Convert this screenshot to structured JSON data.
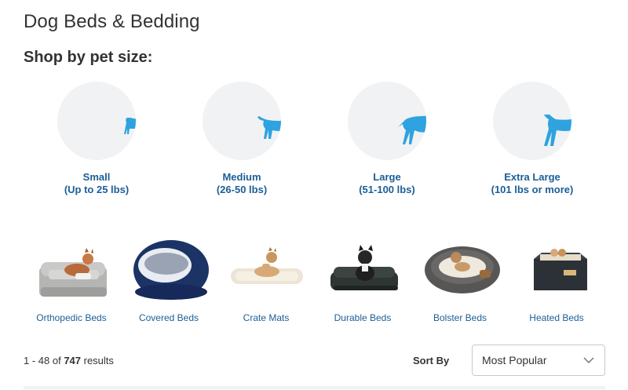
{
  "page": {
    "title": "Dog Beds & Bedding",
    "section_title": "Shop by pet size:"
  },
  "sizes": [
    {
      "name": "Small",
      "range": "(Up to 25 lbs)",
      "icon": "small-dog-icon"
    },
    {
      "name": "Medium",
      "range": "(26-50 lbs)",
      "icon": "medium-dog-icon"
    },
    {
      "name": "Large",
      "range": "(51-100 lbs)",
      "icon": "large-dog-icon"
    },
    {
      "name": "Extra Large",
      "range": "(101 lbs or more)",
      "icon": "extra-large-dog-icon"
    }
  ],
  "categories": [
    {
      "label": "Orthopedic Beds"
    },
    {
      "label": "Covered Beds"
    },
    {
      "label": "Crate Mats"
    },
    {
      "label": "Durable Beds"
    },
    {
      "label": "Bolster Beds"
    },
    {
      "label": "Heated Beds"
    }
  ],
  "results": {
    "prefix": "1 - 48 of ",
    "count": "747",
    "suffix": " results"
  },
  "sort": {
    "label": "Sort By",
    "selected": "Most Popular"
  },
  "colors": {
    "accent_blue": "#1c5e96",
    "icon_blue": "#2ea3df",
    "circle_bg": "#f1f2f4"
  }
}
